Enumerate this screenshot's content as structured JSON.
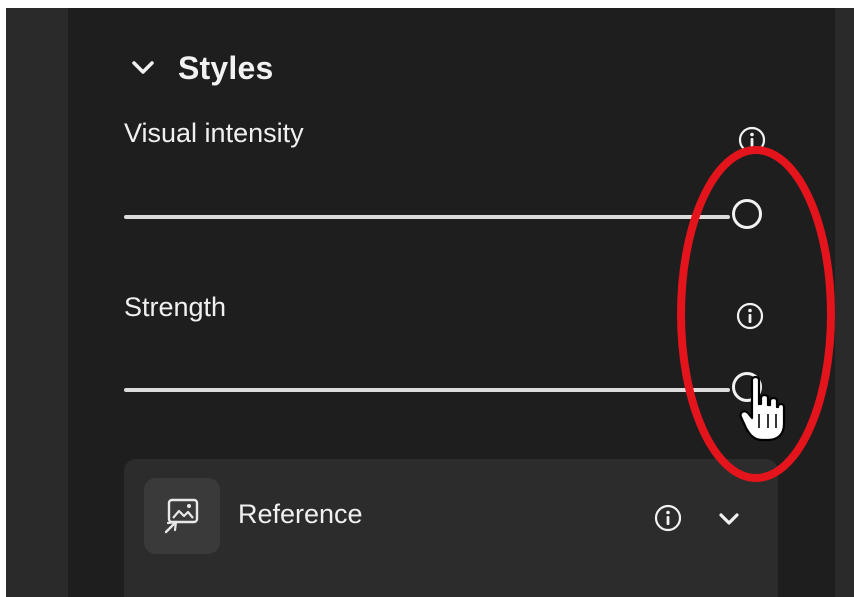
{
  "styles_section": {
    "title": "Styles",
    "expanded": true
  },
  "visual_intensity": {
    "label": "Visual intensity",
    "info_icon": "info-icon",
    "value_fraction": 1.0
  },
  "strength": {
    "label": "Strength",
    "info_icon": "info-icon",
    "value_fraction": 1.0
  },
  "reference": {
    "label": "Reference",
    "icon": "image-reference-icon",
    "info_icon": "info-icon",
    "expand_icon": "chevron-down-icon"
  },
  "annotation": {
    "shape": "ellipse",
    "color": "#e3141b"
  },
  "colors": {
    "panel_bg": "#1e1e1e",
    "text": "#f0f0f0",
    "track": "#dcdcdc"
  }
}
